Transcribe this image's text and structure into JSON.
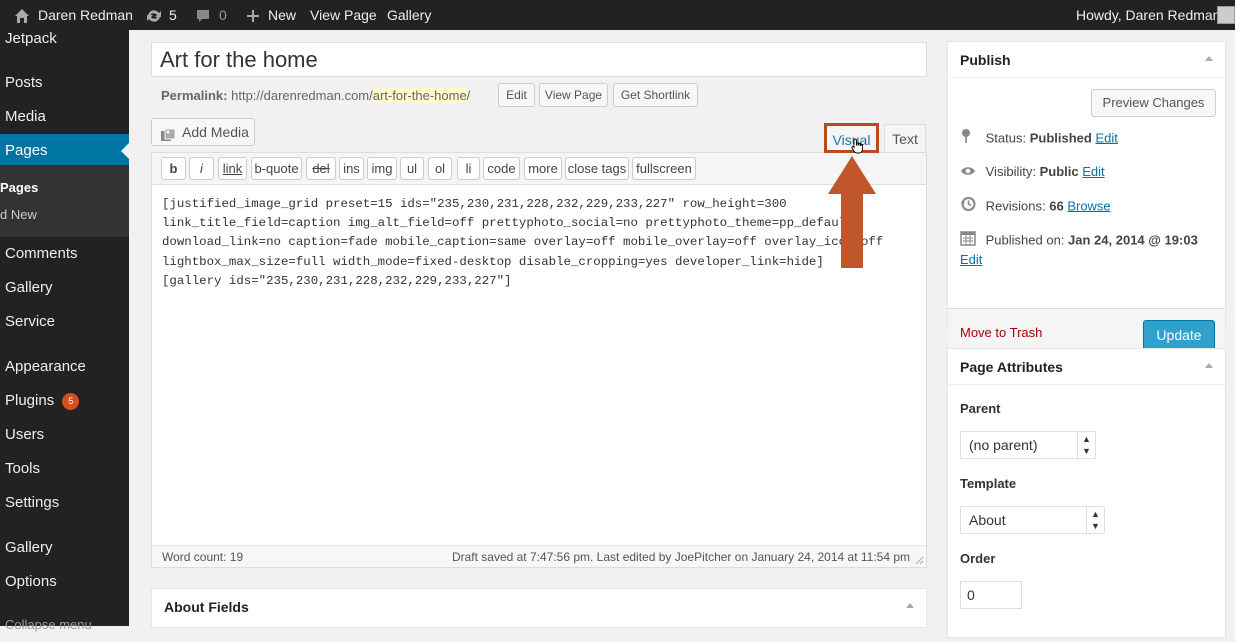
{
  "adminbar": {
    "site_name": "Daren Redman",
    "updates_count": "5",
    "comments_count": "0",
    "new_label": "New",
    "view_page_label": "View Page",
    "gallery_label": "Gallery",
    "howdy": "Howdy, Daren Redman"
  },
  "sidebar": {
    "items": [
      {
        "label": "Jetpack"
      },
      {
        "label": "Posts"
      },
      {
        "label": "Media"
      },
      {
        "label": "Pages"
      },
      {
        "label": "Comments"
      },
      {
        "label": "Gallery"
      },
      {
        "label": "Service"
      },
      {
        "label": "Appearance"
      },
      {
        "label": "Plugins",
        "badge": "5"
      },
      {
        "label": "Users"
      },
      {
        "label": "Tools"
      },
      {
        "label": "Settings"
      },
      {
        "label": "Gallery"
      },
      {
        "label": "Options"
      },
      {
        "label": "Collapse menu"
      }
    ],
    "submenu": [
      {
        "label": "Pages"
      },
      {
        "label": "d New"
      }
    ]
  },
  "editor": {
    "title": "Art for the home",
    "permalink_label": "Permalink:",
    "permalink_base": "http://darenredman.com/",
    "permalink_slug": "art-for-the-home",
    "permalink_end": "/",
    "edit_btn": "Edit",
    "view_page_btn": "View Page",
    "shortlink_btn": "Get Shortlink",
    "add_media": "Add Media",
    "tab_visual": "Visual",
    "tab_text": "Text",
    "quicktags": [
      "b",
      "i",
      "link",
      "b-quote",
      "del",
      "ins",
      "img",
      "ul",
      "ol",
      "li",
      "code",
      "more",
      "close tags",
      "fullscreen"
    ],
    "content_lines": [
      "[justified_image_grid preset=15 ids=\"235,230,231,228,232,229,233,227\" row_height=300",
      "link_title_field=caption img_alt_field=off prettyphoto_social=no prettyphoto_theme=pp_default",
      "download_link=no caption=fade mobile_caption=same overlay=off mobile_overlay=off overlay_icon=off",
      "lightbox_max_size=full width_mode=fixed-desktop disable_cropping=yes developer_link=hide]",
      "[gallery ids=\"235,230,231,228,232,229,233,227\"]"
    ],
    "word_count": "Word count: 19",
    "draft_status": "Draft saved at 7:47:56 pm. Last edited by JoePitcher on January 24, 2014 at 11:54 pm"
  },
  "about_fields": {
    "title": "About Fields"
  },
  "publish": {
    "title": "Publish",
    "preview_btn": "Preview Changes",
    "status_label": "Status:",
    "status_value": "Published",
    "visibility_label": "Visibility:",
    "visibility_value": "Public",
    "revisions_label": "Revisions:",
    "revisions_value": "66",
    "browse": "Browse",
    "published_on_label": "Published on:",
    "published_on_value": "Jan 24, 2014 @ 19:03",
    "edit": "Edit",
    "trash": "Move to Trash",
    "update_btn": "Update"
  },
  "page_attributes": {
    "title": "Page Attributes",
    "parent_label": "Parent",
    "parent_value": "(no parent)",
    "template_label": "Template",
    "template_value": "About",
    "order_label": "Order",
    "order_value": "0"
  },
  "colors": {
    "adminbar_bg": "#222222",
    "accent_blue": "#0074a2",
    "highlight_box": "#b94a1e",
    "arrow": "#c0562a",
    "update_btn": "#2ea2cc"
  }
}
